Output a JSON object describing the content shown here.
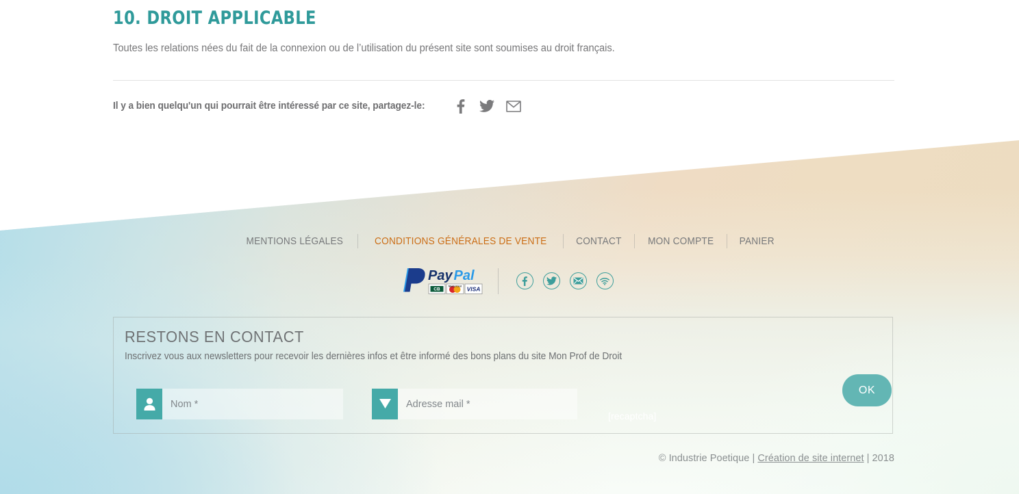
{
  "article": {
    "heading": "10. DROIT APPLICABLE",
    "paragraph": "Toutes les relations nées du fait de la connexion ou de l’utilisation du présent site sont soumises au droit français."
  },
  "share": {
    "label": "Il y a bien quelqu'un qui pourrait être intéressé par ce site, partagez-le:",
    "icons": [
      {
        "name": "facebook-icon",
        "glyph": "facebook"
      },
      {
        "name": "twitter-icon",
        "glyph": "twitter"
      },
      {
        "name": "email-icon",
        "glyph": "envelope"
      }
    ],
    "icon_color": "#7b7b7d"
  },
  "footer_nav": {
    "items": [
      {
        "label": "MENTIONS LÉGALES",
        "active": false
      },
      {
        "label": "CONDITIONS GÉNÉRALES DE VENTE",
        "active": true
      },
      {
        "label": "CONTACT",
        "active": false
      },
      {
        "label": "MON COMPTE",
        "active": false
      },
      {
        "label": "PANIER",
        "active": false
      }
    ],
    "active_color": "#cb6d15",
    "default_color": "#76787a"
  },
  "payments": {
    "paypal_pay": "Pay",
    "paypal_pal": "Pal",
    "cards": [
      "CB",
      "MasterCard",
      "VISA"
    ]
  },
  "socials": [
    {
      "name": "facebook-circle-icon",
      "glyph": "facebook"
    },
    {
      "name": "twitter-circle-icon",
      "glyph": "twitter"
    },
    {
      "name": "email-circle-icon",
      "glyph": "envelope"
    },
    {
      "name": "rss-circle-icon",
      "glyph": "rss"
    }
  ],
  "socials_color": "#3d9e9b",
  "newsletter": {
    "title": "RESTONS EN CONTACT",
    "subtitle": "Inscrivez vous aux newsletters pour recevoir les dernières infos et être informé des bons plans du site Mon Prof de Droit",
    "name_placeholder": "Nom *",
    "email_placeholder": "Adresse mail *",
    "name_value": "",
    "email_value": "",
    "recaptcha_label": "[recaptcha]",
    "submit_label": "OK",
    "submit_color": "#63b6b4",
    "icon_bg_color": "#45aaa8"
  },
  "copyright": {
    "prefix": "© Industrie Poetique | ",
    "link": "Création de site internet",
    "suffix": " | 2018"
  },
  "theme": {
    "heading_color": "#2f9a9a",
    "body_text_color": "#78787a"
  }
}
